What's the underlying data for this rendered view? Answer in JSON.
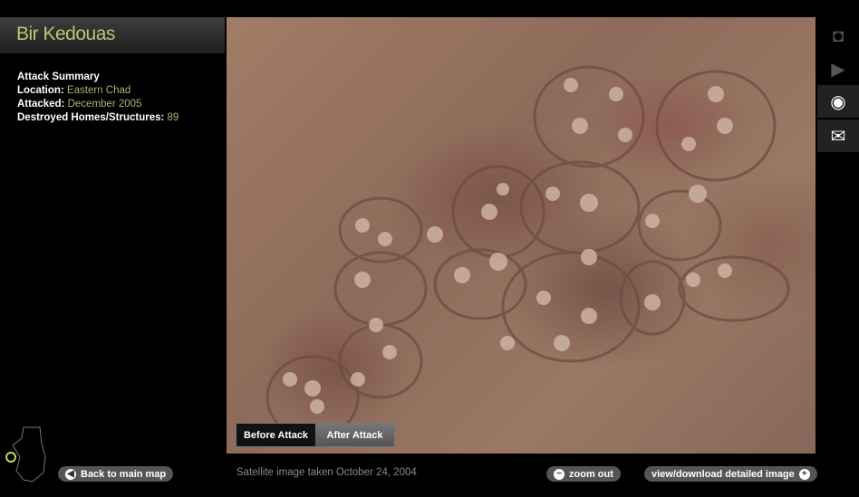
{
  "title": "Bir Kedouas",
  "summary": {
    "heading": "Attack Summary",
    "location_label": "Location:",
    "location_value": "Eastern Chad",
    "attacked_label": "Attacked:",
    "attacked_value": "December 2005",
    "destroyed_label": "Destroyed Homes/Structures:",
    "destroyed_value": "89"
  },
  "toggle": {
    "before": "Before Attack",
    "after": "After Attack",
    "selected": "before"
  },
  "caption": "Satellite image taken October 24, 2004",
  "buttons": {
    "back": "Back to main map",
    "zoom_out": "zoom out",
    "download": "view/download detailed image"
  },
  "side_icons": [
    "camera-icon",
    "video-camera-icon",
    "eye-icon",
    "envelope-icon"
  ],
  "colors": {
    "title_green": "#b4c86e",
    "value_green": "#a4b870"
  }
}
